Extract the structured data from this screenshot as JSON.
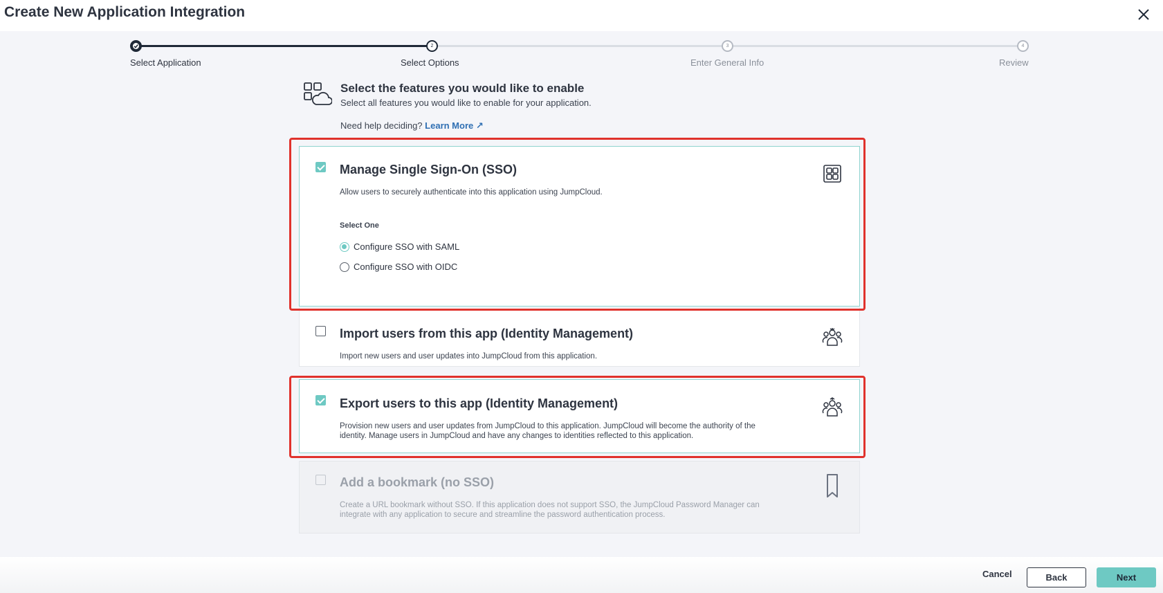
{
  "header": {
    "title": "Create New Application Integration"
  },
  "stepper": {
    "steps": [
      {
        "number": "1",
        "label": "Select Application"
      },
      {
        "number": "2",
        "label": "Select Options"
      },
      {
        "number": "3",
        "label": "Enter General Info"
      },
      {
        "number": "4",
        "label": "Review"
      }
    ]
  },
  "features": {
    "title": "Select the features you would like to enable",
    "subtitle": "Select all features you would like to enable for your application.",
    "help_text": "Need help deciding?",
    "help_link": "Learn More",
    "help_link_arrow": "↗"
  },
  "cards": {
    "sso": {
      "title": "Manage Single Sign-On (SSO)",
      "desc": "Allow users to securely authenticate into this application using JumpCloud.",
      "select_one": "Select One",
      "option_saml": "Configure SSO with SAML",
      "option_oidc": "Configure SSO with OIDC",
      "checked": true,
      "selected_option": "saml"
    },
    "import": {
      "title": "Import users from this app (Identity Management)",
      "desc": "Import new users and user updates into JumpCloud from this application.",
      "checked": false
    },
    "export": {
      "title": "Export users to this app (Identity Management)",
      "desc_line1": "Provision new users and user updates from JumpCloud to this application. JumpCloud will become the authority of the",
      "desc_line2": "identity. Manage users in JumpCloud and have any changes to identities reflected to this application.",
      "checked": true
    },
    "bookmark": {
      "title": "Add a bookmark (no SSO)",
      "desc_line1": "Create a URL bookmark without SSO. If this application does not support SSO, the JumpCloud Password Manager can",
      "desc_line2": "integrate with any application to secure and streamline the password authentication process.",
      "checked": false,
      "disabled": true
    }
  },
  "footer": {
    "cancel": "Cancel",
    "back": "Back",
    "next": "Next"
  },
  "colors": {
    "accent": "#6ec9c3",
    "highlight": "#e0322c",
    "link": "#2f6fb3",
    "dark": "#1f2937"
  }
}
